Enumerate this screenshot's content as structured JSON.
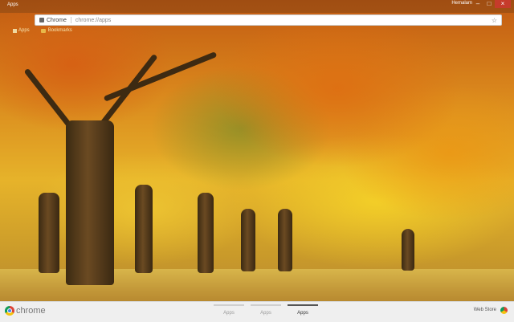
{
  "window": {
    "user": "Hemalam",
    "controls": [
      "–",
      "□",
      "×"
    ]
  },
  "tab": {
    "label": "Apps"
  },
  "omnibox": {
    "label": "Chrome",
    "url": "chrome://apps"
  },
  "bookmarks_bar": {
    "apps_label": "Apps",
    "folder_label": "Bookmarks"
  },
  "bottom_bar": {
    "brand": "chrome",
    "pages": [
      "Apps",
      "Apps",
      "Apps"
    ],
    "active_page_index": 2,
    "webstore_label": "Web Store"
  }
}
